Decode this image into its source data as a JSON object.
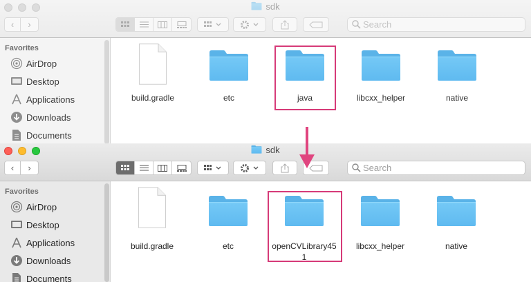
{
  "windows": [
    {
      "title": "sdk",
      "search_placeholder": "Search",
      "sidebar": {
        "heading": "Favorites",
        "items": [
          {
            "label": "AirDrop",
            "icon": "airdrop-icon"
          },
          {
            "label": "Desktop",
            "icon": "desktop-icon"
          },
          {
            "label": "Applications",
            "icon": "applications-icon"
          },
          {
            "label": "Downloads",
            "icon": "downloads-icon"
          },
          {
            "label": "Documents",
            "icon": "documents-icon"
          }
        ]
      },
      "files": [
        {
          "name": "build.gradle",
          "kind": "document"
        },
        {
          "name": "etc",
          "kind": "folder"
        },
        {
          "name": "java",
          "kind": "folder",
          "highlighted": true
        },
        {
          "name": "libcxx_helper",
          "kind": "folder"
        },
        {
          "name": "native",
          "kind": "folder"
        }
      ]
    },
    {
      "title": "sdk",
      "search_placeholder": "Search",
      "sidebar": {
        "heading": "Favorites",
        "items": [
          {
            "label": "AirDrop",
            "icon": "airdrop-icon"
          },
          {
            "label": "Desktop",
            "icon": "desktop-icon"
          },
          {
            "label": "Applications",
            "icon": "applications-icon"
          },
          {
            "label": "Downloads",
            "icon": "downloads-icon"
          },
          {
            "label": "Documents",
            "icon": "documents-icon"
          }
        ]
      },
      "files": [
        {
          "name": "build.gradle",
          "kind": "document"
        },
        {
          "name": "etc",
          "kind": "folder"
        },
        {
          "name": "openCVLibrary451",
          "kind": "folder",
          "highlighted": true
        },
        {
          "name": "libcxx_helper",
          "kind": "folder"
        },
        {
          "name": "native",
          "kind": "folder"
        }
      ]
    }
  ],
  "colors": {
    "folder": "#6cc4f5",
    "highlight": "#d63a78",
    "arrow": "#e0457f"
  }
}
